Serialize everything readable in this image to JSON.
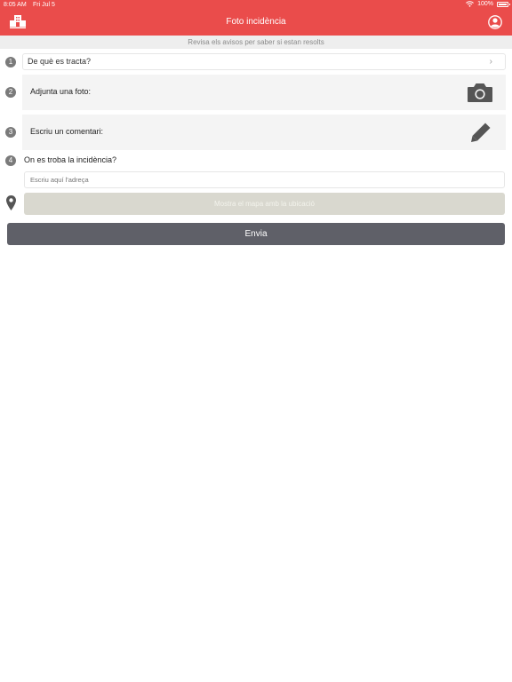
{
  "status_bar": {
    "time": "8:05 AM",
    "date": "Fri Jul 5",
    "battery": "100%"
  },
  "header": {
    "title": "Foto incidència"
  },
  "notice": {
    "text": "Revisa els avisos per saber si estan resolts"
  },
  "steps": [
    {
      "number": "1",
      "label": "De què es tracta?"
    },
    {
      "number": "2",
      "label": "Adjunta una foto:"
    },
    {
      "number": "3",
      "label": "Escriu un comentari:"
    },
    {
      "number": "4",
      "label": "On es troba la incidència?"
    }
  ],
  "address": {
    "placeholder": "Escriu aquí l'adreça"
  },
  "map_button": {
    "label": "Mostra el mapa amb la ubicació"
  },
  "send_button": {
    "label": "Envia"
  },
  "icons": {
    "app": "building-icon",
    "profile": "user-icon",
    "photo": "camera-icon",
    "comment": "pencil-icon",
    "location": "map-pin-icon",
    "select": "chevron-right-icon"
  },
  "colors": {
    "header": "#ea4c4b",
    "send_button": "#5f6068",
    "map_button": "#d9d8cf"
  }
}
